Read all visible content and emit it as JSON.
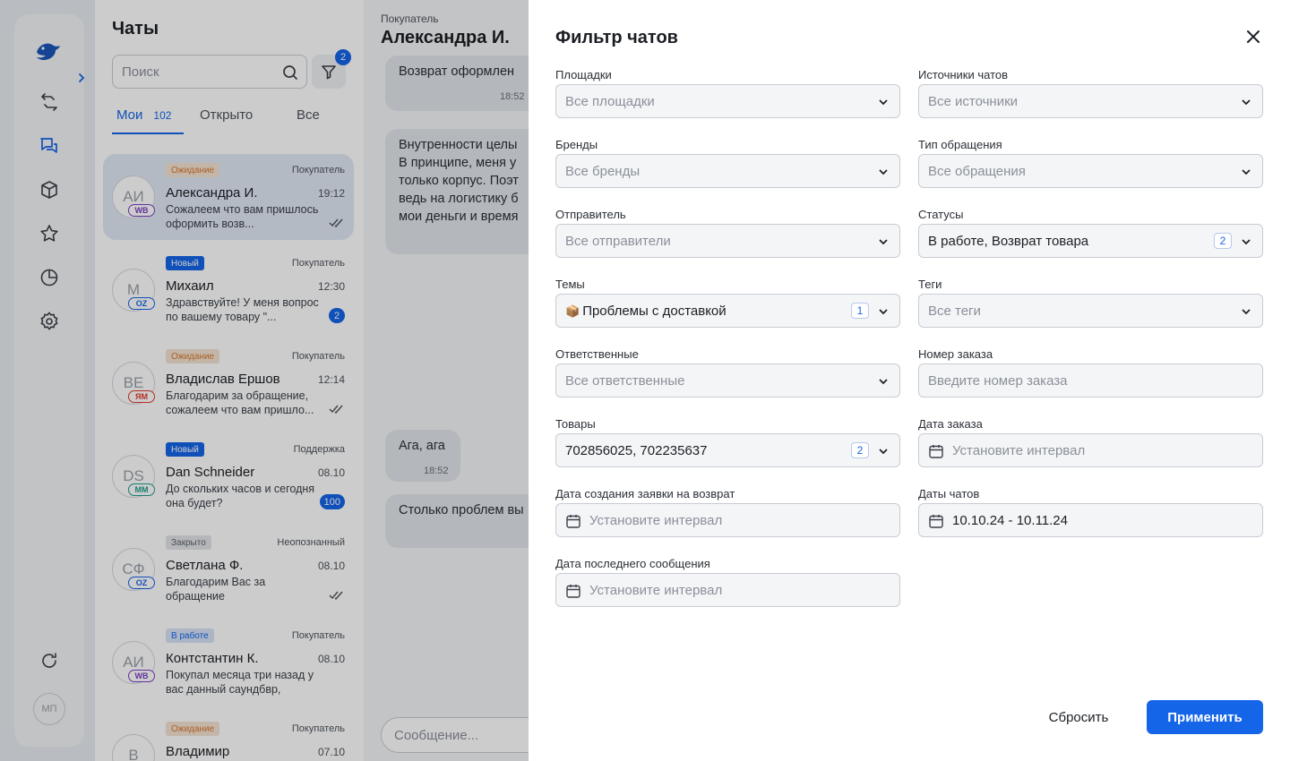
{
  "sidebar": {
    "user_initials": "МП"
  },
  "chats": {
    "title": "Чаты",
    "search_placeholder": "Поиск",
    "filter_count": "2",
    "tabs": [
      {
        "label": "Мои",
        "count": "102"
      },
      {
        "label": "Открыто"
      },
      {
        "label": "Все"
      }
    ],
    "items": [
      {
        "badge": "Ожидание",
        "role": "Покупатель",
        "initials": "АИ",
        "marketplace": "WB",
        "name": "Александра И.",
        "time": "19:12",
        "preview": "Сожалеем что вам пришлось оформить возв..."
      },
      {
        "badge": "Новый",
        "role": "Покупатель",
        "initials": "М",
        "marketplace": "OZ",
        "name": "Михаил",
        "time": "12:30",
        "preview": "Здравствуйте! У меня вопрос по вашему товару \"...",
        "unread": "2"
      },
      {
        "badge": "Ожидание",
        "role": "Покупатель",
        "initials": "ВЕ",
        "marketplace": "ЯМ",
        "name": "Владислав Ершов",
        "time": "12:14",
        "preview": "Благодарим за обращение, сожалеем что вам пришло..."
      },
      {
        "badge": "Новый",
        "role": "Поддержка",
        "initials": "DS",
        "marketplace": "ММ",
        "name": "Dan Schneider",
        "time": "08.10",
        "preview": "До скольких часов и сегодня она будет?",
        "unread": "100"
      },
      {
        "badge": "Закрыто",
        "role": "Неопознанный",
        "initials": "СФ",
        "marketplace": "OZ",
        "name": "Светлана Ф.",
        "time": "08.10",
        "preview": "Благодарим Вас за обращение"
      },
      {
        "badge": "В работе",
        "role": "Покупатель",
        "initials": "АИ",
        "marketplace": "WB",
        "name": "Контстантин К.",
        "time": "08.10",
        "preview": "Покупал месяца три назад у вас данный саундбвр, появил..."
      },
      {
        "badge": "Ожидание",
        "role": "Покупатель",
        "initials": "В",
        "name": "Владимир",
        "time": "07.10"
      }
    ]
  },
  "conversation": {
    "label": "Покупатель",
    "name": "Александра И.",
    "messages": [
      {
        "text": "Возврат оформлен",
        "time": "18:52"
      },
      {
        "text": "Внутренности целы В принципе, меня у только корпус. Поэт ведь на логистику б мои деньги и время"
      },
      {
        "text": "Ага, ага",
        "time": "18:52"
      },
      {
        "text": "Столько проблем вы"
      }
    ],
    "input_placeholder": "Сообщение..."
  },
  "filter": {
    "title": "Фильтр чатов",
    "fields": {
      "platforms": {
        "label": "Площадки",
        "value": "Все площадки"
      },
      "sources": {
        "label": "Источники чатов",
        "value": "Все источники"
      },
      "brands": {
        "label": "Бренды",
        "value": "Все бренды"
      },
      "request_type": {
        "label": "Тип обращения",
        "value": "Все обращения"
      },
      "sender": {
        "label": "Отправитель",
        "value": "Все отправители"
      },
      "statuses": {
        "label": "Статусы",
        "value": "В работе, Возврат товара",
        "count": "2"
      },
      "topics": {
        "label": "Темы",
        "value": "Проблемы с доставкой",
        "icon": "📦",
        "count": "1"
      },
      "tags": {
        "label": "Теги",
        "value": "Все теги"
      },
      "assignees": {
        "label": "Ответственные",
        "value": "Все ответственные"
      },
      "order_number": {
        "label": "Номер заказа",
        "placeholder": "Введите номер заказа"
      },
      "products": {
        "label": "Товары",
        "value": "702856025, 702235637",
        "count": "2"
      },
      "order_date": {
        "label": "Дата заказа",
        "placeholder": "Установите интервал"
      },
      "return_date": {
        "label": "Дата создания заявки на возврат",
        "placeholder": "Установите интервал"
      },
      "chat_dates": {
        "label": "Даты чатов",
        "value": "10.10.24 - 10.11.24"
      },
      "last_message_date": {
        "label": "Дата последнего сообщения",
        "placeholder": "Установите интервал"
      }
    },
    "reset_label": "Сбросить",
    "apply_label": "Применить"
  },
  "colors": {
    "accent": "#1565e8",
    "badge_waiting": "#f4e3d2",
    "badge_new": "#1565e8",
    "badge_closed": "#e2e4e8",
    "badge_in_work": "#d6e3f8",
    "overlay": "rgba(0,0,0,0.2)"
  }
}
